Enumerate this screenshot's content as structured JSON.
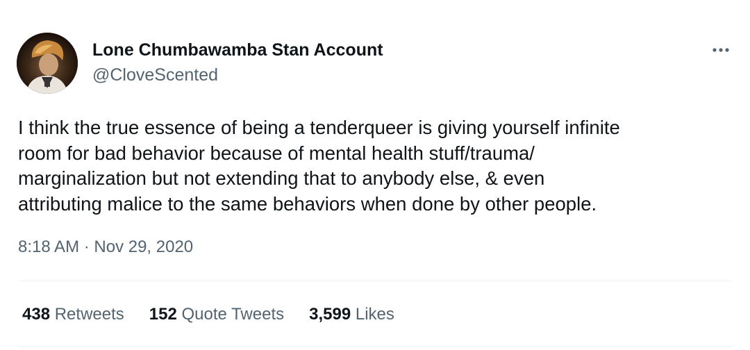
{
  "author": {
    "display_name": "Lone Chumbawamba Stan Account",
    "handle": "@CloveScented"
  },
  "tweet": {
    "text": "I think the true essence of being a tenderqueer is giving yourself infinite\nroom for bad behavior because of mental health stuff/trauma/\nmarginalization but not extending that to anybody else, & even\nattributing malice to the same behaviors  when done by other people.",
    "timestamp": "8:18 AM · Nov 29, 2020"
  },
  "stats": {
    "retweets": {
      "count": "438",
      "label": "Retweets"
    },
    "quote_tweets": {
      "count": "152",
      "label": "Quote Tweets"
    },
    "likes": {
      "count": "3,599",
      "label": "Likes"
    }
  },
  "icons": {
    "more": "more-horizontal-icon"
  },
  "colors": {
    "text_primary": "#0f1419",
    "text_secondary": "#536471",
    "divider": "#eff3f4"
  }
}
